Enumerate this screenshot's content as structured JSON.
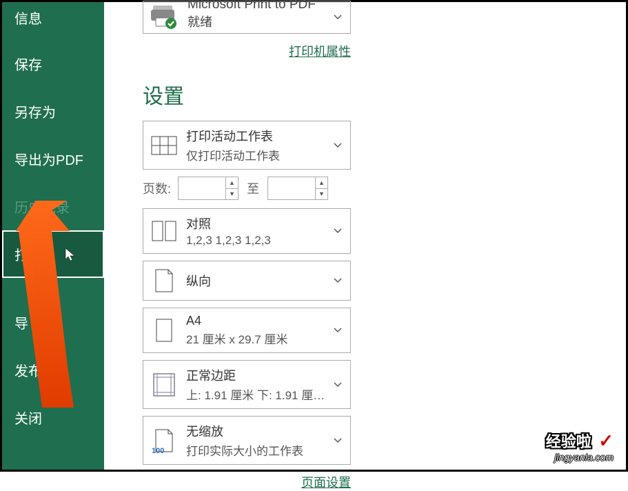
{
  "sidebar": {
    "items": [
      {
        "label": "信息"
      },
      {
        "label": "保存"
      },
      {
        "label": "另存为"
      },
      {
        "label": "导出为PDF"
      },
      {
        "label": "历史记录"
      },
      {
        "label": "打印"
      },
      {
        "label": "导"
      },
      {
        "label": "发布"
      },
      {
        "label": "关闭"
      }
    ]
  },
  "printer": {
    "name": "Microsoft Print to PDF",
    "status": "就绪",
    "properties_link": "打印机属性"
  },
  "settings": {
    "title": "设置",
    "active_sheet": {
      "line1": "打印活动工作表",
      "line2": "仅打印活动工作表"
    },
    "pages_label": "页数:",
    "pages_to": "至",
    "collate": {
      "line1": "对照",
      "line2": "1,2,3    1,2,3    1,2,3"
    },
    "orientation": {
      "line1": "纵向"
    },
    "paper": {
      "line1": "A4",
      "line2": "21 厘米 x 29.7 厘米"
    },
    "margins": {
      "line1": "正常边距",
      "line2": "上: 1.91 厘米 下: 1.91 厘…"
    },
    "scaling": {
      "line1": "无缩放",
      "line2": "打印实际大小的工作表",
      "badge": "100"
    },
    "page_setup_link": "页面设置"
  },
  "watermark": {
    "title": "经验啦",
    "url": "jingyanla.com"
  }
}
